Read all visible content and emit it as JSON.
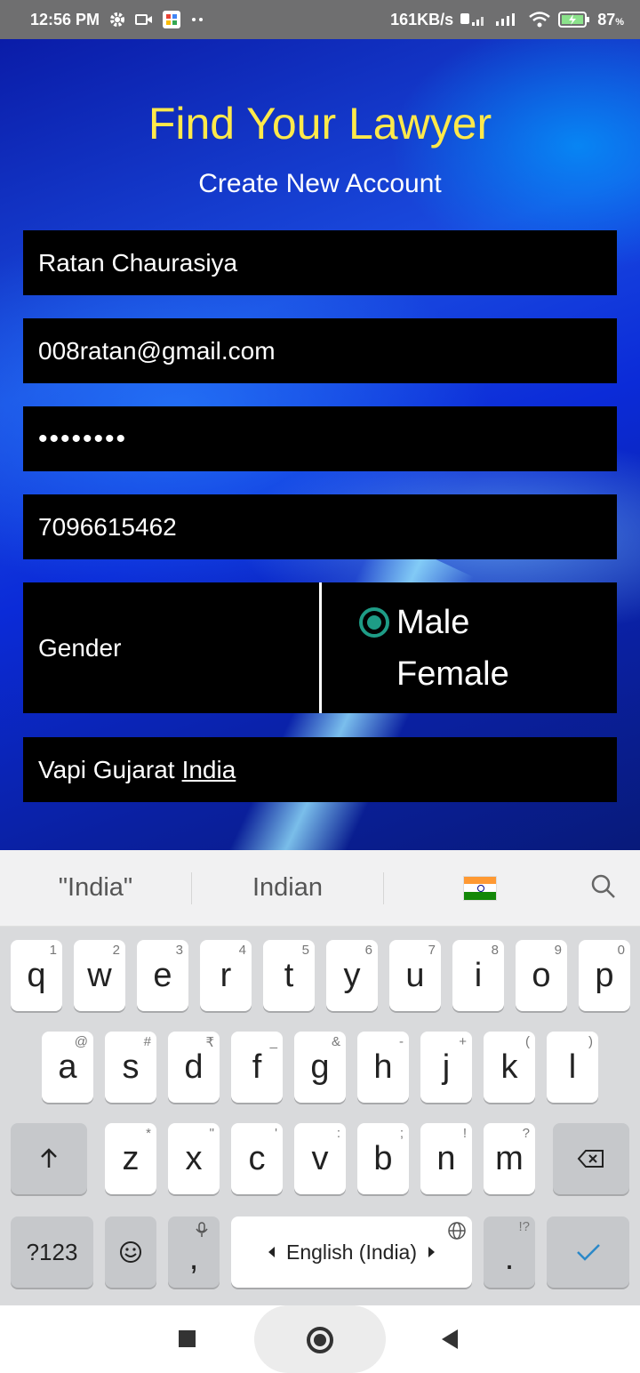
{
  "status_bar": {
    "time": "12:56 PM",
    "net_speed": "161KB/s",
    "battery": "87"
  },
  "app": {
    "title": "Find Your Lawyer",
    "subtitle": "Create New Account",
    "fields": {
      "name": "Ratan Chaurasiya",
      "email": "008ratan@gmail.com",
      "password_mask": "••••••••",
      "phone": "7096615462",
      "address_prefix": "Vapi Gujarat",
      "address_composing": "India"
    },
    "gender": {
      "label": "Gender",
      "options": [
        "Male",
        "Female"
      ],
      "selected": "Male"
    },
    "colors": {
      "title": "#ffe94a",
      "radio": "#1e9c86"
    }
  },
  "keyboard": {
    "suggestions": [
      "\"India\"",
      "Indian",
      "indian-flag-emoji"
    ],
    "rows": [
      [
        [
          "q",
          "1"
        ],
        [
          "w",
          "2"
        ],
        [
          "e",
          "3"
        ],
        [
          "r",
          "4"
        ],
        [
          "t",
          "5"
        ],
        [
          "y",
          "6"
        ],
        [
          "u",
          "7"
        ],
        [
          "i",
          "8"
        ],
        [
          "o",
          "9"
        ],
        [
          "p",
          "0"
        ]
      ],
      [
        [
          "a",
          "@"
        ],
        [
          "s",
          "#"
        ],
        [
          "d",
          "₹"
        ],
        [
          "f",
          "_"
        ],
        [
          "g",
          "&"
        ],
        [
          "h",
          "-"
        ],
        [
          "j",
          "+"
        ],
        [
          "k",
          "("
        ],
        [
          "l",
          ")"
        ]
      ],
      [
        [
          "z",
          "*"
        ],
        [
          "x",
          "\""
        ],
        [
          "c",
          "'"
        ],
        [
          "v",
          ":"
        ],
        [
          "b",
          ";"
        ],
        [
          "n",
          "!"
        ],
        [
          "m",
          "?"
        ]
      ]
    ],
    "symbols_label": "?123",
    "comma": ",",
    "space_label": "English (India)",
    "period": ".",
    "period_hint": "!?"
  }
}
